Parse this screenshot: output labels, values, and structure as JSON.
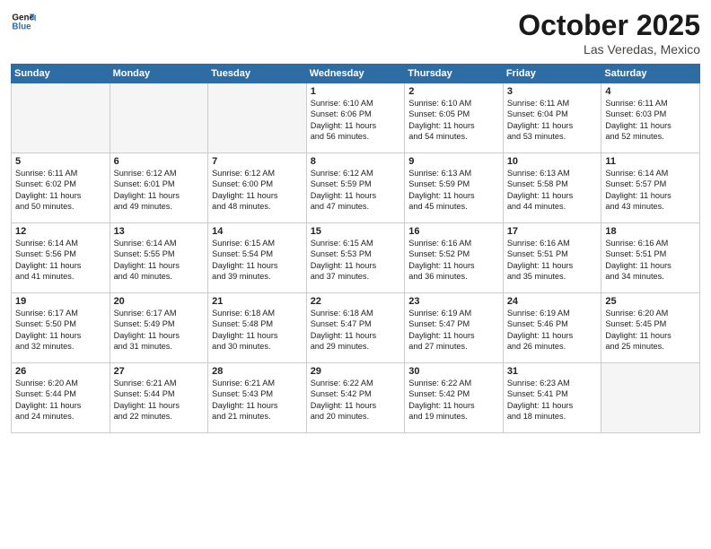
{
  "header": {
    "logo_general": "General",
    "logo_blue": "Blue",
    "month": "October 2025",
    "location": "Las Veredas, Mexico"
  },
  "weekdays": [
    "Sunday",
    "Monday",
    "Tuesday",
    "Wednesday",
    "Thursday",
    "Friday",
    "Saturday"
  ],
  "weeks": [
    [
      {
        "day": "",
        "info": ""
      },
      {
        "day": "",
        "info": ""
      },
      {
        "day": "",
        "info": ""
      },
      {
        "day": "1",
        "info": "Sunrise: 6:10 AM\nSunset: 6:06 PM\nDaylight: 11 hours\nand 56 minutes."
      },
      {
        "day": "2",
        "info": "Sunrise: 6:10 AM\nSunset: 6:05 PM\nDaylight: 11 hours\nand 54 minutes."
      },
      {
        "day": "3",
        "info": "Sunrise: 6:11 AM\nSunset: 6:04 PM\nDaylight: 11 hours\nand 53 minutes."
      },
      {
        "day": "4",
        "info": "Sunrise: 6:11 AM\nSunset: 6:03 PM\nDaylight: 11 hours\nand 52 minutes."
      }
    ],
    [
      {
        "day": "5",
        "info": "Sunrise: 6:11 AM\nSunset: 6:02 PM\nDaylight: 11 hours\nand 50 minutes."
      },
      {
        "day": "6",
        "info": "Sunrise: 6:12 AM\nSunset: 6:01 PM\nDaylight: 11 hours\nand 49 minutes."
      },
      {
        "day": "7",
        "info": "Sunrise: 6:12 AM\nSunset: 6:00 PM\nDaylight: 11 hours\nand 48 minutes."
      },
      {
        "day": "8",
        "info": "Sunrise: 6:12 AM\nSunset: 5:59 PM\nDaylight: 11 hours\nand 47 minutes."
      },
      {
        "day": "9",
        "info": "Sunrise: 6:13 AM\nSunset: 5:59 PM\nDaylight: 11 hours\nand 45 minutes."
      },
      {
        "day": "10",
        "info": "Sunrise: 6:13 AM\nSunset: 5:58 PM\nDaylight: 11 hours\nand 44 minutes."
      },
      {
        "day": "11",
        "info": "Sunrise: 6:14 AM\nSunset: 5:57 PM\nDaylight: 11 hours\nand 43 minutes."
      }
    ],
    [
      {
        "day": "12",
        "info": "Sunrise: 6:14 AM\nSunset: 5:56 PM\nDaylight: 11 hours\nand 41 minutes."
      },
      {
        "day": "13",
        "info": "Sunrise: 6:14 AM\nSunset: 5:55 PM\nDaylight: 11 hours\nand 40 minutes."
      },
      {
        "day": "14",
        "info": "Sunrise: 6:15 AM\nSunset: 5:54 PM\nDaylight: 11 hours\nand 39 minutes."
      },
      {
        "day": "15",
        "info": "Sunrise: 6:15 AM\nSunset: 5:53 PM\nDaylight: 11 hours\nand 37 minutes."
      },
      {
        "day": "16",
        "info": "Sunrise: 6:16 AM\nSunset: 5:52 PM\nDaylight: 11 hours\nand 36 minutes."
      },
      {
        "day": "17",
        "info": "Sunrise: 6:16 AM\nSunset: 5:51 PM\nDaylight: 11 hours\nand 35 minutes."
      },
      {
        "day": "18",
        "info": "Sunrise: 6:16 AM\nSunset: 5:51 PM\nDaylight: 11 hours\nand 34 minutes."
      }
    ],
    [
      {
        "day": "19",
        "info": "Sunrise: 6:17 AM\nSunset: 5:50 PM\nDaylight: 11 hours\nand 32 minutes."
      },
      {
        "day": "20",
        "info": "Sunrise: 6:17 AM\nSunset: 5:49 PM\nDaylight: 11 hours\nand 31 minutes."
      },
      {
        "day": "21",
        "info": "Sunrise: 6:18 AM\nSunset: 5:48 PM\nDaylight: 11 hours\nand 30 minutes."
      },
      {
        "day": "22",
        "info": "Sunrise: 6:18 AM\nSunset: 5:47 PM\nDaylight: 11 hours\nand 29 minutes."
      },
      {
        "day": "23",
        "info": "Sunrise: 6:19 AM\nSunset: 5:47 PM\nDaylight: 11 hours\nand 27 minutes."
      },
      {
        "day": "24",
        "info": "Sunrise: 6:19 AM\nSunset: 5:46 PM\nDaylight: 11 hours\nand 26 minutes."
      },
      {
        "day": "25",
        "info": "Sunrise: 6:20 AM\nSunset: 5:45 PM\nDaylight: 11 hours\nand 25 minutes."
      }
    ],
    [
      {
        "day": "26",
        "info": "Sunrise: 6:20 AM\nSunset: 5:44 PM\nDaylight: 11 hours\nand 24 minutes."
      },
      {
        "day": "27",
        "info": "Sunrise: 6:21 AM\nSunset: 5:44 PM\nDaylight: 11 hours\nand 22 minutes."
      },
      {
        "day": "28",
        "info": "Sunrise: 6:21 AM\nSunset: 5:43 PM\nDaylight: 11 hours\nand 21 minutes."
      },
      {
        "day": "29",
        "info": "Sunrise: 6:22 AM\nSunset: 5:42 PM\nDaylight: 11 hours\nand 20 minutes."
      },
      {
        "day": "30",
        "info": "Sunrise: 6:22 AM\nSunset: 5:42 PM\nDaylight: 11 hours\nand 19 minutes."
      },
      {
        "day": "31",
        "info": "Sunrise: 6:23 AM\nSunset: 5:41 PM\nDaylight: 11 hours\nand 18 minutes."
      },
      {
        "day": "",
        "info": ""
      }
    ]
  ]
}
